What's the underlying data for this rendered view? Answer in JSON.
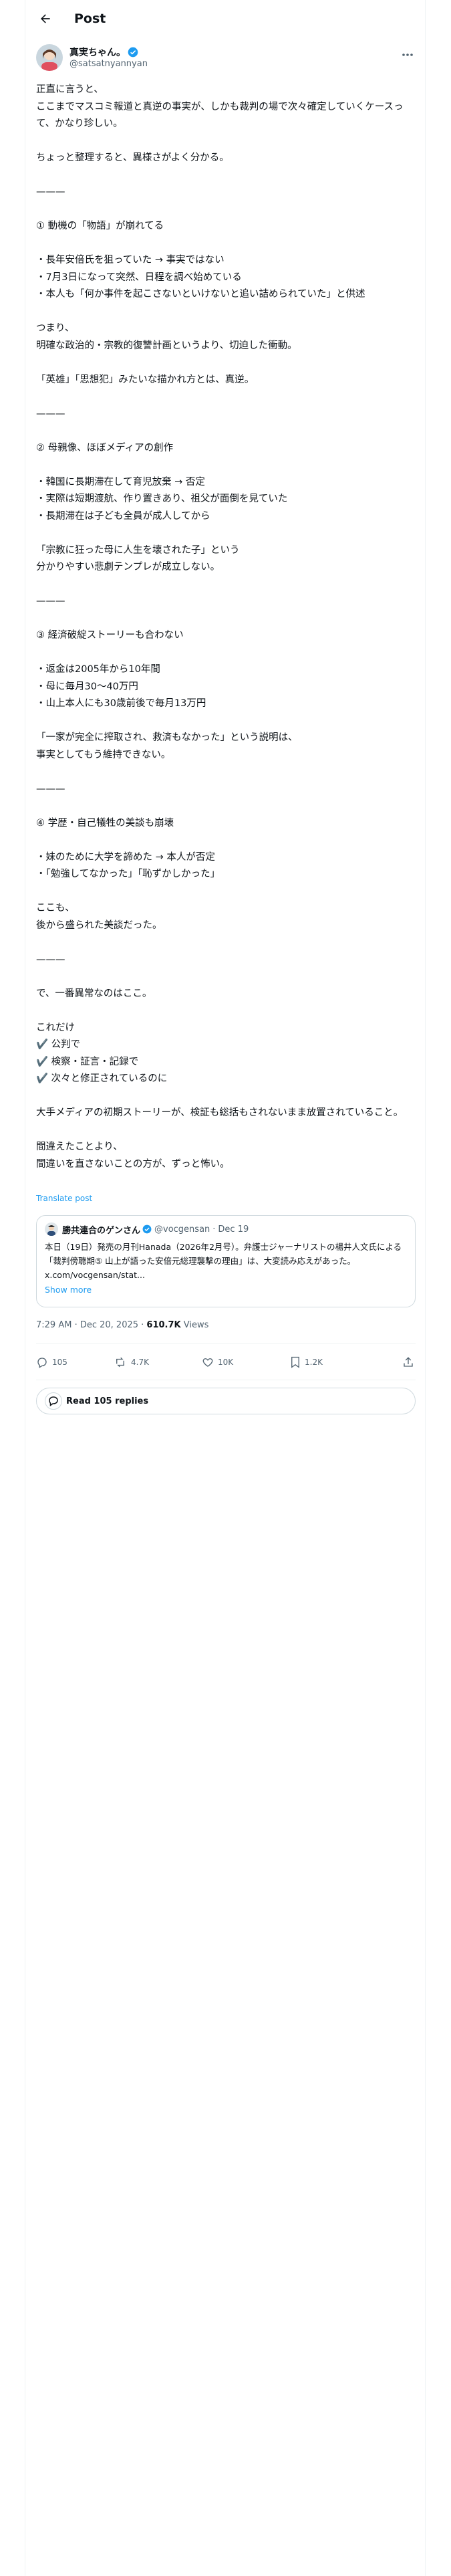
{
  "header": {
    "title": "Post"
  },
  "author": {
    "name": "真実ちゃん。",
    "handle": "@satsatnyannyan"
  },
  "post": {
    "body": "正直に言うと、\nここまでマスコミ報道と真逆の事実が、しかも裁判の場で次々確定していくケースって、かなり珍しい。\n\nちょっと整理すると、異様さがよく分かる。\n\n———\n\n① 動機の「物語」が崩れてる\n\n・長年安倍氏を狙っていた → 事実ではない\n・7月3日になって突然、日程を調べ始めている\n・本人も「何か事件を起こさないといけないと追い詰められていた」と供述\n\nつまり、\n明確な政治的・宗教的復讐計画というより、切迫した衝動。\n\n「英雄」「思想犯」みたいな描かれ方とは、真逆。\n\n———\n\n② 母親像、ほぼメディアの創作\n\n・韓国に長期滞在して育児放棄 → 否定\n・実際は短期渡航、作り置きあり、祖父が面倒を見ていた\n・長期滞在は子ども全員が成人してから\n\n「宗教に狂った母に人生を壊された子」という\n分かりやすい悲劇テンプレが成立しない。\n\n———\n\n③ 経済破綻ストーリーも合わない\n\n・返金は2005年から10年間\n・母に毎月30〜40万円\n・山上本人にも30歳前後で毎月13万円\n\n「一家が完全に搾取され、救済もなかった」という説明は、\n事実としてもう維持できない。\n\n———\n\n④ 学歴・自己犠牲の美談も崩壊\n\n・妹のために大学を諦めた → 本人が否定\n・「勉強してなかった」「恥ずかしかった」\n\nここも、\n後から盛られた美談だった。\n\n———\n\nで、一番異常なのはここ。\n\nこれだけ\n✔️ 公判で\n✔️ 検察・証言・記録で\n✔️ 次々と修正されているのに\n\n大手メディアの初期ストーリーが、検証も総括もされないまま放置されていること。\n\n間違えたことより、\n間違いを直さないことの方が、ずっと怖い。",
    "translate_label": "Translate post"
  },
  "quote": {
    "name": "勝共連合のゲンさん",
    "handle": "@vocgensan",
    "date": "Dec 19",
    "text": "本日（19日）発売の月刊Hanada（2026年2月号）。弁護士ジャーナリストの楊井人文氏による「裁判傍聴期⑤ 山上が語った安倍元総理襲撃の理由」は、大変読み応えがあった。 x.com/vocgensan/stat...",
    "show_more": "Show more"
  },
  "meta": {
    "time": "7:29 AM · Dec 20, 2025 · ",
    "views": "610.7K",
    "views_label": " Views"
  },
  "actions": {
    "replies": "105",
    "reposts": "4.7K",
    "likes": "10K",
    "bookmarks": "1.2K"
  },
  "read_replies": "Read 105 replies",
  "colors": {
    "accent": "#1d9bf0",
    "secondary_text": "#536471",
    "border": "#cfd9de"
  },
  "icons": [
    "back-arrow-icon",
    "verified-badge-icon",
    "more-icon",
    "reply-icon",
    "repost-icon",
    "like-icon",
    "bookmark-icon",
    "share-icon",
    "speech-bubble-icon"
  ]
}
